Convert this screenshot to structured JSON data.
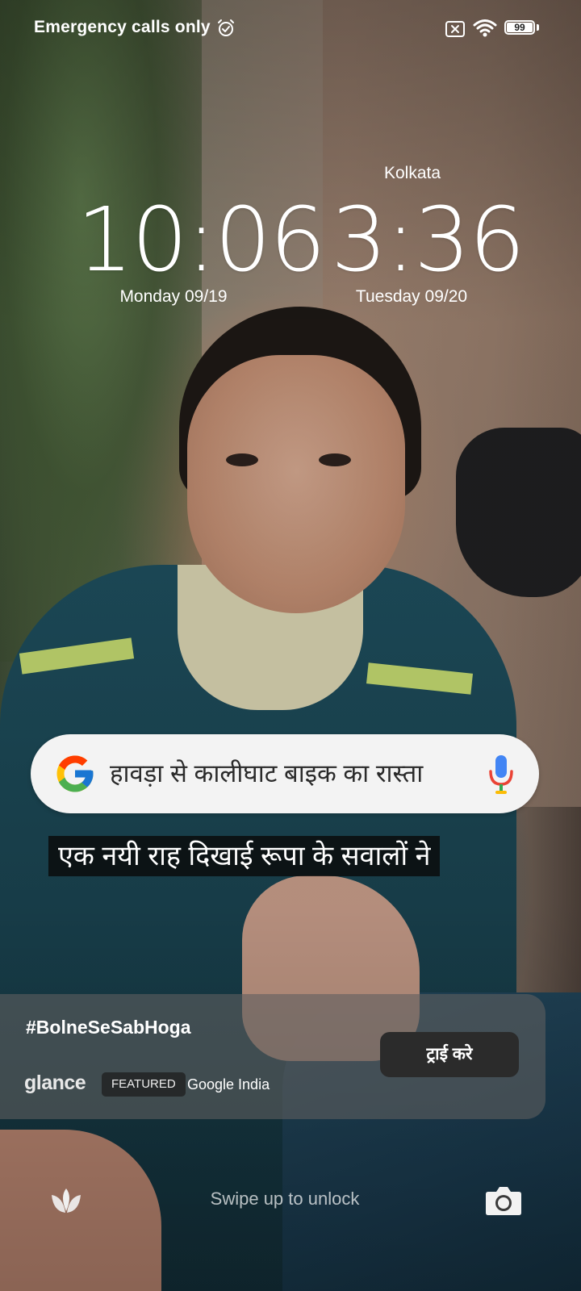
{
  "status_bar": {
    "carrier_text": "Emergency calls only",
    "battery_level": "99",
    "icons": [
      "alarm-icon",
      "sim-off-icon",
      "wifi-icon",
      "battery-icon"
    ]
  },
  "clocks": {
    "local": {
      "time": "10:06",
      "date": "Monday 09/19"
    },
    "world": {
      "city": "Kolkata",
      "time": "3:36",
      "date": "Tuesday 09/20"
    }
  },
  "ad": {
    "search_query": "हावड़ा से कालीघाट बाइक का रास्ता",
    "caption": "एक नयी राह दिखाई रूपा के सवालों ने"
  },
  "glance_card": {
    "hashtag": "#BolneSeSabHoga",
    "brand": "glance",
    "badge": "FEATURED",
    "advertiser": "Google India",
    "cta_label": "ट्राई करे"
  },
  "bottom": {
    "swipe_hint": "Swipe up to unlock",
    "left_icon": "glance-lotus-icon",
    "right_icon": "camera-icon"
  }
}
